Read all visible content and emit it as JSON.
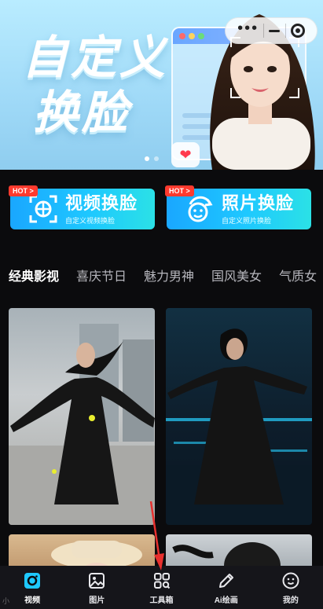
{
  "banner": {
    "title_line1": "自定义",
    "title_line2": "换脸",
    "colors": {
      "sky": "#a6dcf6",
      "window_bar": "#6aa6ff"
    }
  },
  "capsule": {
    "more_icon": "more-dots-icon",
    "minimize_icon": "minimize-icon",
    "close_icon": "target-close-icon"
  },
  "features": [
    {
      "badge": "HOT >",
      "title": "视频换脸",
      "subtitle": "自定义视频换脸",
      "icon": "face-scan-icon"
    },
    {
      "badge": "HOT >",
      "title": "照片换脸",
      "subtitle": "自定义照片换脸",
      "icon": "face-swap-icon"
    }
  ],
  "tabs": [
    {
      "label": "经典影视",
      "active": true
    },
    {
      "label": "喜庆节日",
      "active": false
    },
    {
      "label": "魅力男神",
      "active": false
    },
    {
      "label": "国风美女",
      "active": false
    },
    {
      "label": "气质女",
      "active": false
    }
  ],
  "nav": [
    {
      "label": "视频",
      "icon": "video-camera-icon",
      "active": true
    },
    {
      "label": "图片",
      "icon": "image-icon",
      "active": false
    },
    {
      "label": "工具箱",
      "icon": "grid-apps-icon",
      "active": false
    },
    {
      "label": "Ai绘画",
      "icon": "pencil-icon",
      "active": false
    },
    {
      "label": "我的",
      "icon": "smile-face-icon",
      "active": false
    }
  ],
  "theme": {
    "accent": "#1ec8ff",
    "hot": "#ff3a2e",
    "nav_bg": "#15151a",
    "annotation_arrow": "#e8302e"
  },
  "watermark": "小"
}
